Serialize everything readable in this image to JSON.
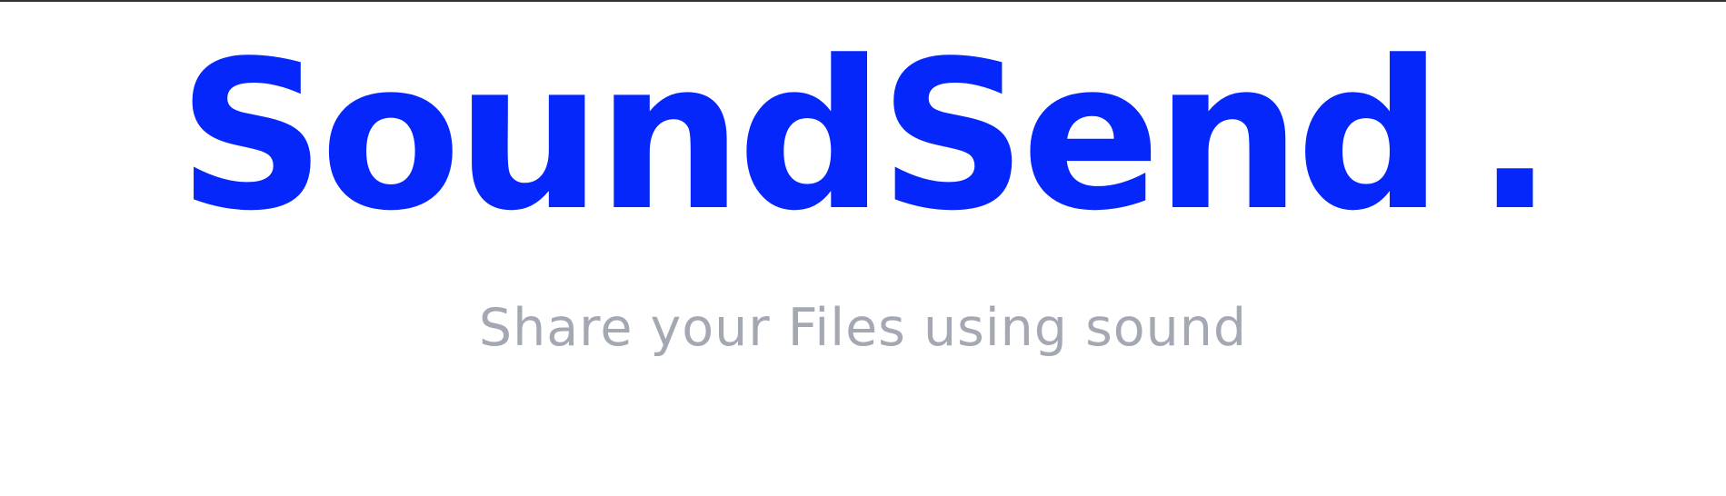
{
  "brand": {
    "name": "SoundSend",
    "dot": ".",
    "tagline": "Share your Files using sound"
  },
  "colors": {
    "brand_blue": "#0527fc",
    "tagline_gray": "#a3a8b3",
    "top_border": "#333333",
    "background": "#ffffff"
  }
}
